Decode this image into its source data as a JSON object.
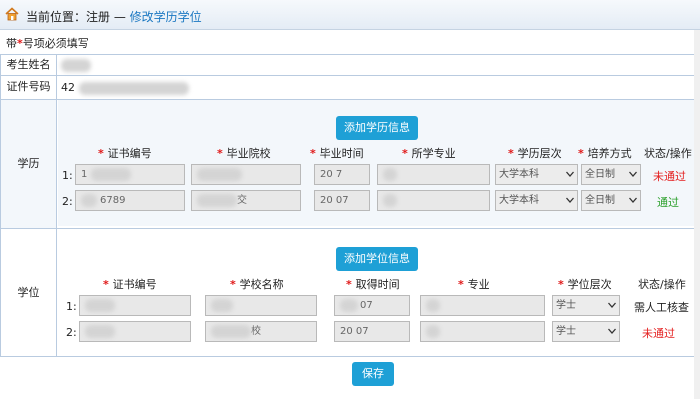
{
  "breadcrumb": {
    "lead": "当前位置：注册 — ",
    "current": "修改学历学位"
  },
  "note": {
    "prefix": "带",
    "star": "*",
    "suffix": "号项必须填写"
  },
  "fields": {
    "name_label": "考生姓名",
    "id_label": "证件号码",
    "id_prefix": "42"
  },
  "education": {
    "section_label": "学历",
    "add_button": "添加学历信息",
    "headers": [
      "证书编号",
      "毕业院校",
      "毕业时间",
      "所学专业",
      "学历层次",
      "培养方式",
      "状态/操作"
    ],
    "rows": [
      {
        "index": "1:",
        "cert": "1",
        "school": "",
        "time": "20  7",
        "major": "",
        "level": "大学本科",
        "mode": "全日制",
        "status": "未通过",
        "status_type": "fail"
      },
      {
        "index": "2:",
        "cert": "6789",
        "school": "交",
        "time": "20  07",
        "major": "",
        "level": "大学本科",
        "mode": "全日制",
        "status": "通过",
        "status_type": "pass"
      }
    ]
  },
  "degree": {
    "section_label": "学位",
    "add_button": "添加学位信息",
    "headers": [
      "证书编号",
      "学校名称",
      "取得时间",
      "专业",
      "学位层次",
      "状态/操作"
    ],
    "rows": [
      {
        "index": "1:",
        "cert": "",
        "school": "",
        "time": "07",
        "major": "",
        "level": "学士",
        "status": "需人工核查",
        "status_type": "manual"
      },
      {
        "index": "2:",
        "cert": "",
        "school": "校",
        "time": "20  07",
        "major": "",
        "level": "学士",
        "status": "未通过",
        "status_type": "fail"
      }
    ]
  },
  "save_button": "保存",
  "colors": {
    "accent": "#1ea0d6",
    "fail": "#e42020",
    "pass": "#2ca02c",
    "required": "#e01818"
  }
}
